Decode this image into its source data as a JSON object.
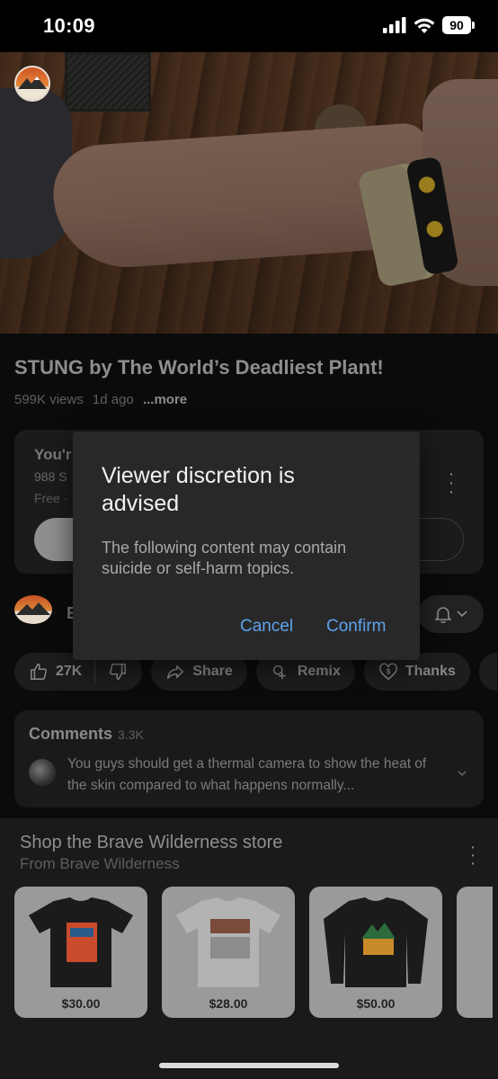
{
  "status_bar": {
    "time": "10:09",
    "battery": "90"
  },
  "video": {
    "title": "STUNG by The World’s Deadliest Plant!",
    "views": "599K views",
    "age": "1d ago",
    "more_label": "...more"
  },
  "context_card": {
    "line1": "You'r",
    "line2": "988 S",
    "line3": "Free ·"
  },
  "channel_row": {
    "initial": "E"
  },
  "actions": {
    "like_count": "27K",
    "share_label": "Share",
    "remix_label": "Remix",
    "thanks_label": "Thanks"
  },
  "comments": {
    "heading": "Comments",
    "count": "3.3K",
    "top_comment": "You guys should get a thermal camera to show the heat of the skin compared to what happens normally..."
  },
  "shop": {
    "heading": "Shop the Brave Wilderness store",
    "subheading": "From Brave Wilderness",
    "products": [
      {
        "price": "$30.00",
        "shirt_color": "#1b1b1b"
      },
      {
        "price": "$28.00",
        "shirt_color": "#b3b3b3"
      },
      {
        "price": "$50.00",
        "shirt_color": "#1b1b1b"
      }
    ]
  },
  "dialog": {
    "title": "Viewer discretion is advised",
    "body": "The following content may contain suicide or self-harm topics.",
    "cancel_label": "Cancel",
    "confirm_label": "Confirm"
  },
  "colors": {
    "accent_link": "#5ea3ee",
    "dialog_bg": "#282828",
    "page_bg": "#0b0b0b"
  }
}
